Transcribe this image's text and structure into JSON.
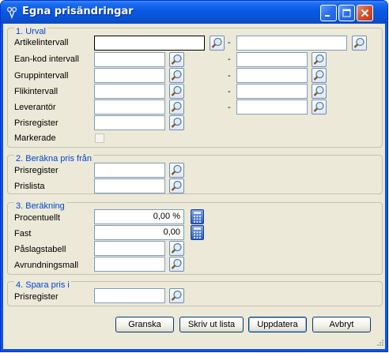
{
  "window": {
    "title": "Egna prisändringar"
  },
  "groups": {
    "urval": {
      "title": "1. Urval",
      "rows": {
        "artikel": "Artikelintervall",
        "eankod": "Ean-kod intervall",
        "grupp": "Gruppintervall",
        "flik": "Flikintervall",
        "leverantor": "Leverantör",
        "prisregister": "Prisregister",
        "markerade": "Markerade"
      },
      "separator": "-"
    },
    "berakna": {
      "title": "2. Beräkna pris från",
      "rows": {
        "prisregister": "Prisregister",
        "prislista": "Prislista"
      }
    },
    "berakning": {
      "title": "3. Beräkning",
      "rows": {
        "procentuellt": "Procentuellt",
        "fast": "Fast",
        "paslagstabell": "Påslagstabell",
        "avrundningsmall": "Avrundningsmall"
      },
      "values": {
        "procentuellt": "0,00 %",
        "fast": "0,00"
      }
    },
    "spara": {
      "title": "4. Spara pris i",
      "rows": {
        "prisregister": "Prisregister"
      }
    }
  },
  "buttons": {
    "granska": "Granska",
    "skriv_ut": "Skriv ut lista",
    "uppdatera": "Uppdatera",
    "avbryt": "Avbryt"
  },
  "icons": {
    "lookup": "magnifier-icon",
    "calculator": "calculator-icon"
  },
  "colors": {
    "titlebar": "#0a54d8",
    "window_bg": "#ece9d8",
    "group_title": "#0046d5",
    "field_border": "#7f9db9",
    "close_button": "#d6502c"
  }
}
